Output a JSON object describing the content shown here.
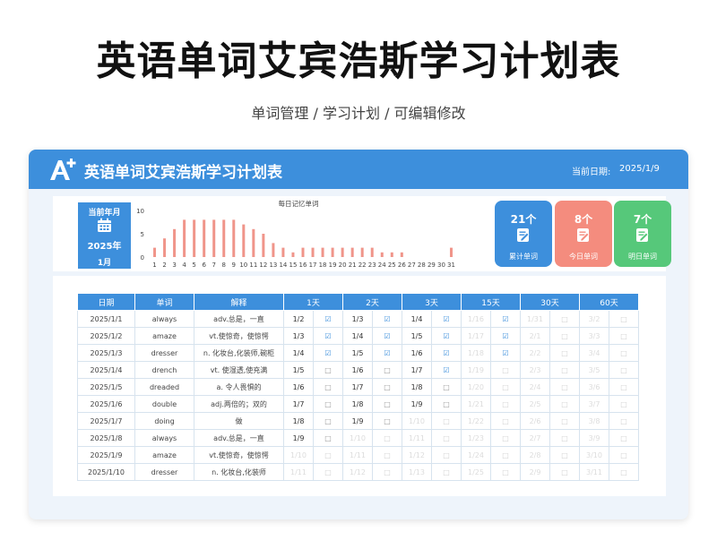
{
  "page": {
    "title": "英语单词艾宾浩斯学习计划表",
    "subtitle": "单词管理 / 学习计划 / 可编辑修改"
  },
  "header": {
    "title": "英语单词艾宾浩斯学习计划表",
    "date_label": "当前日期:",
    "date_value": "2025/1/9"
  },
  "date_box": {
    "label": "当前年月",
    "year": "2025年",
    "month": "1月",
    "icon": "calendar-icon"
  },
  "chart_data": {
    "type": "bar",
    "title": "每日记忆单词",
    "categories": [
      "1",
      "2",
      "3",
      "4",
      "5",
      "6",
      "7",
      "8",
      "9",
      "10",
      "11",
      "12",
      "13",
      "14",
      "15",
      "16",
      "17",
      "18",
      "19",
      "20",
      "21",
      "22",
      "23",
      "24",
      "25",
      "26",
      "27",
      "28",
      "29",
      "30",
      "31"
    ],
    "values": [
      2,
      4,
      6,
      8,
      8,
      8,
      8,
      8,
      8,
      7,
      6,
      5,
      3,
      2,
      1,
      2,
      2,
      2,
      2,
      2,
      2,
      2,
      2,
      1,
      1,
      1,
      0,
      0,
      0,
      0,
      2
    ],
    "ylim": [
      0,
      10
    ],
    "yticks": [
      "0",
      "5",
      "10"
    ],
    "bar_color": "#f0958a",
    "grid": false
  },
  "stats": [
    {
      "value": "21个",
      "label": "累计单词",
      "color": "#3d8fdc",
      "icon": "edit-note-icon"
    },
    {
      "value": "8个",
      "label": "今日单词",
      "color": "#f48c7e",
      "icon": "edit-note-icon"
    },
    {
      "value": "7个",
      "label": "明日单词",
      "color": "#56c87a",
      "icon": "edit-note-icon"
    }
  ],
  "table": {
    "headers": [
      "日期",
      "单词",
      "解释",
      "1天",
      "2天",
      "3天",
      "15天",
      "30天",
      "60天"
    ],
    "marks": {
      "done": "☑",
      "todo": "□"
    },
    "rows": [
      {
        "date": "2025/1/1",
        "word": "always",
        "meaning": "adv.总是，一直",
        "reviews": [
          {
            "d": "1/2",
            "s": "done"
          },
          {
            "d": "1/3",
            "s": "done"
          },
          {
            "d": "1/4",
            "s": "done"
          },
          {
            "d": "1/16",
            "s": "done",
            "f": true
          },
          {
            "d": "1/31",
            "s": "todo",
            "f": true
          },
          {
            "d": "3/2",
            "s": "todo",
            "f": true
          }
        ]
      },
      {
        "date": "2025/1/2",
        "word": "amaze",
        "meaning": "vt.使惊奇，使惊愕",
        "reviews": [
          {
            "d": "1/3",
            "s": "done"
          },
          {
            "d": "1/4",
            "s": "done"
          },
          {
            "d": "1/5",
            "s": "done"
          },
          {
            "d": "1/17",
            "s": "done",
            "f": true
          },
          {
            "d": "2/1",
            "s": "todo",
            "f": true
          },
          {
            "d": "3/3",
            "s": "todo",
            "f": true
          }
        ]
      },
      {
        "date": "2025/1/3",
        "word": "dresser",
        "meaning": "n. 化妆台,化装师,碗柜",
        "reviews": [
          {
            "d": "1/4",
            "s": "done"
          },
          {
            "d": "1/5",
            "s": "done"
          },
          {
            "d": "1/6",
            "s": "done"
          },
          {
            "d": "1/18",
            "s": "done",
            "f": true
          },
          {
            "d": "2/2",
            "s": "todo",
            "f": true
          },
          {
            "d": "3/4",
            "s": "todo",
            "f": true
          }
        ]
      },
      {
        "date": "2025/1/4",
        "word": "drench",
        "meaning": "vt. 使湿透,使充满",
        "reviews": [
          {
            "d": "1/5",
            "s": "todo"
          },
          {
            "d": "1/6",
            "s": "todo"
          },
          {
            "d": "1/7",
            "s": "done"
          },
          {
            "d": "1/19",
            "s": "todo",
            "f": true
          },
          {
            "d": "2/3",
            "s": "todo",
            "f": true
          },
          {
            "d": "3/5",
            "s": "todo",
            "f": true
          }
        ]
      },
      {
        "date": "2025/1/5",
        "word": "dreaded",
        "meaning": "a. 令人畏惧的",
        "reviews": [
          {
            "d": "1/6",
            "s": "todo"
          },
          {
            "d": "1/7",
            "s": "todo"
          },
          {
            "d": "1/8",
            "s": "todo"
          },
          {
            "d": "1/20",
            "s": "todo",
            "f": true
          },
          {
            "d": "2/4",
            "s": "todo",
            "f": true
          },
          {
            "d": "3/6",
            "s": "todo",
            "f": true
          }
        ]
      },
      {
        "date": "2025/1/6",
        "word": "double",
        "meaning": "adj.两倍的；双的",
        "reviews": [
          {
            "d": "1/7",
            "s": "todo"
          },
          {
            "d": "1/8",
            "s": "todo"
          },
          {
            "d": "1/9",
            "s": "todo"
          },
          {
            "d": "1/21",
            "s": "todo",
            "f": true
          },
          {
            "d": "2/5",
            "s": "todo",
            "f": true
          },
          {
            "d": "3/7",
            "s": "todo",
            "f": true
          }
        ]
      },
      {
        "date": "2025/1/7",
        "word": "doing",
        "meaning": "做",
        "reviews": [
          {
            "d": "1/8",
            "s": "todo"
          },
          {
            "d": "1/9",
            "s": "todo"
          },
          {
            "d": "1/10",
            "s": "todo",
            "f": true
          },
          {
            "d": "1/22",
            "s": "todo",
            "f": true
          },
          {
            "d": "2/6",
            "s": "todo",
            "f": true
          },
          {
            "d": "3/8",
            "s": "todo",
            "f": true
          }
        ]
      },
      {
        "date": "2025/1/8",
        "word": "always",
        "meaning": "adv.总是，一直",
        "reviews": [
          {
            "d": "1/9",
            "s": "todo"
          },
          {
            "d": "1/10",
            "s": "todo",
            "f": true
          },
          {
            "d": "1/11",
            "s": "todo",
            "f": true
          },
          {
            "d": "1/23",
            "s": "todo",
            "f": true
          },
          {
            "d": "2/7",
            "s": "todo",
            "f": true
          },
          {
            "d": "3/9",
            "s": "todo",
            "f": true
          }
        ]
      },
      {
        "date": "2025/1/9",
        "word": "amaze",
        "meaning": "vt.使惊奇，使惊愕",
        "reviews": [
          {
            "d": "1/10",
            "s": "todo",
            "f": true
          },
          {
            "d": "1/11",
            "s": "todo",
            "f": true
          },
          {
            "d": "1/12",
            "s": "todo",
            "f": true
          },
          {
            "d": "1/24",
            "s": "todo",
            "f": true
          },
          {
            "d": "2/8",
            "s": "todo",
            "f": true
          },
          {
            "d": "3/10",
            "s": "todo",
            "f": true
          }
        ]
      },
      {
        "date": "2025/1/10",
        "word": "dresser",
        "meaning": "n. 化妆台,化装师",
        "reviews": [
          {
            "d": "1/11",
            "s": "todo",
            "f": true
          },
          {
            "d": "1/12",
            "s": "todo",
            "f": true
          },
          {
            "d": "1/13",
            "s": "todo",
            "f": true
          },
          {
            "d": "1/25",
            "s": "todo",
            "f": true
          },
          {
            "d": "2/9",
            "s": "todo",
            "f": true
          },
          {
            "d": "3/11",
            "s": "todo",
            "f": true
          }
        ]
      }
    ]
  }
}
